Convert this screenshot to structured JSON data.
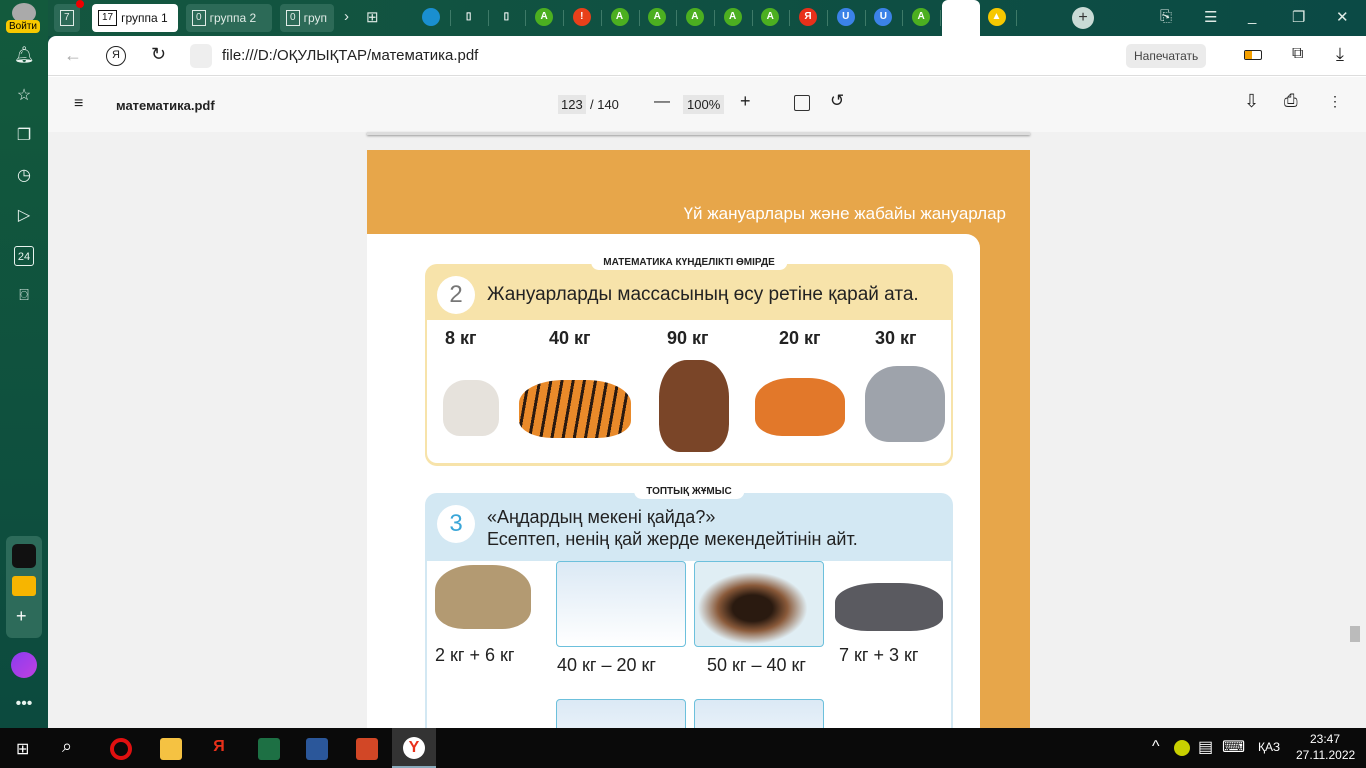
{
  "sidebar": {
    "login": "Войти",
    "items": [
      "bell-icon",
      "star-icon",
      "collections-icon",
      "history-icon",
      "video-icon",
      "news-icon",
      "screenshot-icon"
    ],
    "news_label": "24"
  },
  "tabs": {
    "home_count": "7",
    "groups": [
      {
        "count": "17",
        "label": "группа 1"
      },
      {
        "count": "0",
        "label": "группа 2"
      },
      {
        "count": "0",
        "label": "груп"
      }
    ],
    "favicons": [
      {
        "t": "",
        "c": "#1a8fd0"
      },
      {
        "t": "▯",
        "c": "transparent"
      },
      {
        "t": "▯",
        "c": "transparent"
      },
      {
        "t": "A",
        "c": "#4caf20"
      },
      {
        "t": "!",
        "c": "#e8401a"
      },
      {
        "t": "A",
        "c": "#4caf20"
      },
      {
        "t": "A",
        "c": "#4caf20"
      },
      {
        "t": "A",
        "c": "#4caf20"
      },
      {
        "t": "A",
        "c": "#4caf20"
      },
      {
        "t": "A",
        "c": "#4caf20"
      },
      {
        "t": "Я",
        "c": "#e8301a"
      },
      {
        "t": "U",
        "c": "#3b82e8"
      },
      {
        "t": "U",
        "c": "#3b82e8"
      },
      {
        "t": "A",
        "c": "#4caf20"
      },
      {
        "t": "Я",
        "c": "#e8301a"
      },
      {
        "t": "▲",
        "c": "#f7c800"
      }
    ]
  },
  "address": {
    "url": "file:///D:/ОҚУЛЫҚТАР/математика.pdf",
    "print_label": "Напечатать"
  },
  "pdf": {
    "filename": "математика.pdf",
    "current_page": "123",
    "total_pages": "/ 140",
    "zoom": "100%"
  },
  "page": {
    "header": "Үй жануарлары және жабайы жануарлар",
    "ex2": {
      "tag": "МАТЕМАТИКА КҮНДЕЛІКТІ ӨМІРДЕ",
      "number": "2",
      "title": "Жануарларды массасының өсу ретіне қарай ата.",
      "weights": [
        "8 кг",
        "40 кг",
        "90 кг",
        "20 кг",
        "30 кг"
      ],
      "animals": [
        "rabbit",
        "tiger",
        "bear",
        "fox",
        "wolf"
      ]
    },
    "ex3": {
      "tag": "ТОПТЫҚ ЖҰМЫС",
      "number": "3",
      "title1": "«Аңдардың мекені қайда?»",
      "title2": "Есептеп, ненің қай жерде мекендейтінін айт.",
      "expressions": [
        "2 кг + 6 кг",
        "40 кг – 20 кг",
        "50 кг – 40 кг",
        "7 кг + 3 кг"
      ]
    }
  },
  "taskbar": {
    "lang": "ҚАЗ",
    "time": "23:47",
    "date": "27.11.2022"
  },
  "colors": {
    "page_orange": "#e7a64a",
    "ex2_bg": "#f7e3aa",
    "ex3_bg": "#d3e8f3",
    "accent_blue": "#3aa6d8"
  }
}
